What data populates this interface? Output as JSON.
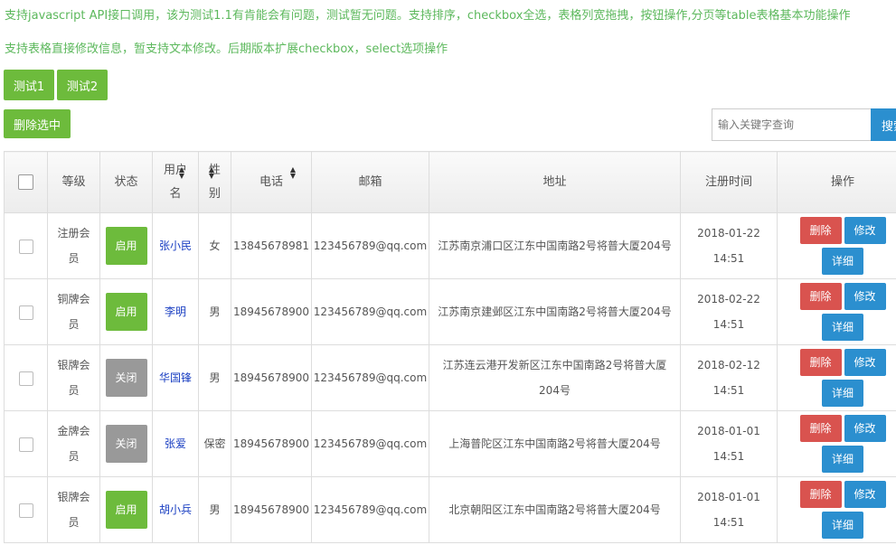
{
  "intro": {
    "line1": "支持javascript API接口调用，该为测试1.1有肯能会有问题，测试暂无问题。支持排序，checkbox全选，表格列宽拖拽，按钮操作,分页等table表格基本功能操作",
    "line2": "支持表格直接修改信息，暂支持文本修改。后期版本扩展checkbox，select选项操作"
  },
  "toolbar": {
    "test1": "测试1",
    "test2": "测试2",
    "delete_selected": "删除选中"
  },
  "search": {
    "placeholder": "输入关键字查询",
    "button": "搜索"
  },
  "columns": {
    "level": "等级",
    "status": "状态",
    "username": "用户名",
    "gender": "性别",
    "phone": "电话",
    "email": "邮箱",
    "address": "地址",
    "reg_time": "注册时间",
    "actions": "操作"
  },
  "actions": {
    "delete": "删除",
    "edit": "修改",
    "detail": "详细"
  },
  "rows": [
    {
      "level": "注册会员",
      "status": "启用",
      "status_on": true,
      "username": "张小民",
      "gender": "女",
      "phone": "13845678981",
      "email": "123456789@qq.com",
      "address": "江苏南京浦口区江东中国南路2号将普大厦204号",
      "date": "2018-01-22",
      "time": "14:51"
    },
    {
      "level": "铜牌会员",
      "status": "启用",
      "status_on": true,
      "username": "李明",
      "gender": "男",
      "phone": "18945678900",
      "email": "123456789@qq.com",
      "address": "江苏南京建邺区江东中国南路2号将普大厦204号",
      "date": "2018-02-22",
      "time": "14:51"
    },
    {
      "level": "银牌会员",
      "status": "关闭",
      "status_on": false,
      "username": "华国锋",
      "gender": "男",
      "phone": "18945678900",
      "email": "123456789@qq.com",
      "address": "江苏连云港开发新区江东中国南路2号将普大厦204号",
      "date": "2018-02-12",
      "time": "14:51"
    },
    {
      "level": "金牌会员",
      "status": "关闭",
      "status_on": false,
      "username": "张爱",
      "gender": "保密",
      "phone": "18945678900",
      "email": "123456789@qq.com",
      "address": "上海普陀区江东中国南路2号将普大厦204号",
      "date": "2018-01-01",
      "time": "14:51"
    },
    {
      "level": "银牌会员",
      "status": "启用",
      "status_on": true,
      "username": "胡小兵",
      "gender": "男",
      "phone": "18945678900",
      "email": "123456789@qq.com",
      "address": "北京朝阳区江东中国南路2号将普大厦204号",
      "date": "2018-01-01",
      "time": "14:51"
    }
  ],
  "colors": {
    "green": "#6dbb3c",
    "blue": "#2b8fcf",
    "red": "#d9534f",
    "gray": "#999999",
    "intro_text": "#5cb85c"
  }
}
